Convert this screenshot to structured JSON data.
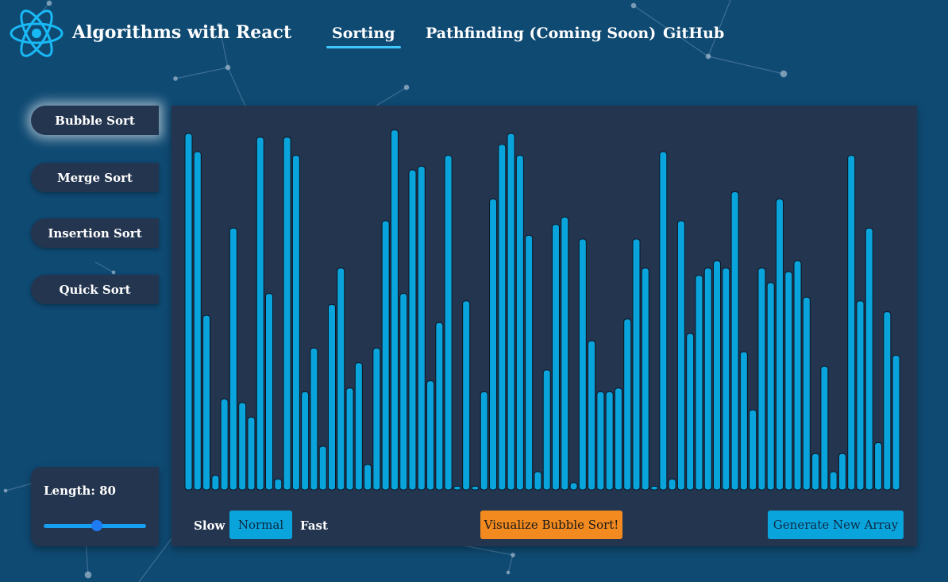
{
  "header": {
    "title": "Algorithms with React",
    "nav": [
      {
        "label": "Sorting",
        "active": true
      },
      {
        "label": "Pathfinding (Coming Soon)",
        "active": false
      },
      {
        "label": "GitHub",
        "active": false
      }
    ]
  },
  "sidebar": {
    "algorithms": [
      {
        "label": "Bubble Sort",
        "active": true
      },
      {
        "label": "Merge Sort",
        "active": false
      },
      {
        "label": "Insertion Sort",
        "active": false
      },
      {
        "label": "Quick Sort",
        "active": false
      }
    ]
  },
  "length_control": {
    "label": "Length: 80",
    "value": 80,
    "slider_fraction": 0.52
  },
  "controls": {
    "slow_label": "Slow",
    "speed_value": "Normal",
    "fast_label": "Fast",
    "visualize_label": "Visualize Bubble Sort!",
    "generate_label": "Generate New Array"
  },
  "array": {
    "values": [
      98,
      93,
      48,
      4,
      25,
      72,
      24,
      20,
      97,
      54,
      3,
      97,
      92,
      27,
      39,
      12,
      51,
      61,
      28,
      35,
      7,
      39,
      74,
      99,
      54,
      88,
      89,
      30,
      46,
      92,
      1,
      52,
      1,
      27,
      80,
      95,
      98,
      92,
      70,
      5,
      33,
      73,
      75,
      2,
      69,
      41,
      27,
      27,
      28,
      47,
      69,
      61,
      1,
      93,
      3,
      74,
      43,
      59,
      61,
      63,
      61,
      82,
      38,
      22,
      61,
      57,
      80,
      60,
      63,
      53,
      10,
      34,
      5,
      10,
      92,
      52,
      72,
      13,
      49,
      37
    ],
    "max_value": 100
  },
  "colors": {
    "background": "#0f4a73",
    "panel": "#24354f",
    "bar": "#0aa4dd",
    "accent": "#3fc8ff",
    "visualize_button": "#f28a1f"
  }
}
